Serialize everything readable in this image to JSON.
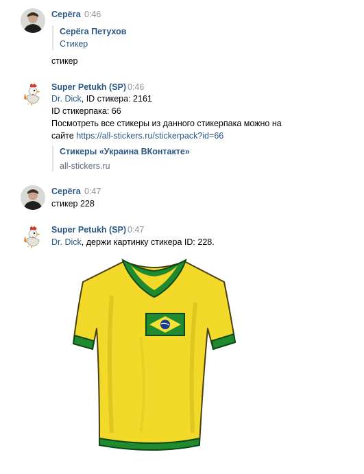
{
  "messages": [
    {
      "author": "Серёга",
      "time": "0:46",
      "reply": {
        "title": "Серёга Петухов",
        "subtitle": "Стикер"
      },
      "text": "стикер"
    },
    {
      "author": "Super Petukh (SP)",
      "time": "0:46",
      "mention": "Dr. Dick",
      "line1_rest": ", ID стикера: 2161",
      "line2": "ID стикерпака: 66",
      "line3": "Посмотреть все стикеры из данного стикерпака можно на",
      "line4_prefix": "сайте ",
      "line4_link": "https://all-stickers.ru/stickerpack?id=66",
      "snippet": {
        "title": "Стикеры «Украина ВКонтакте»",
        "domain": "all-stickers.ru"
      }
    },
    {
      "author": "Серёга",
      "time": "0:47",
      "text": "стикер 228"
    },
    {
      "author": "Super Petukh (SP)",
      "time": "0:47",
      "mention": "Dr. Dick",
      "line1_rest": ", держи картинку стикера ID: 228.",
      "sticker_icon": "brazil-jersey-sticker"
    }
  ],
  "colors": {
    "link": "#2a5885",
    "time": "#939393",
    "quote_border": "#dfe2e8",
    "jersey_yellow": "#f2d92a",
    "jersey_green": "#1f8a2e"
  }
}
